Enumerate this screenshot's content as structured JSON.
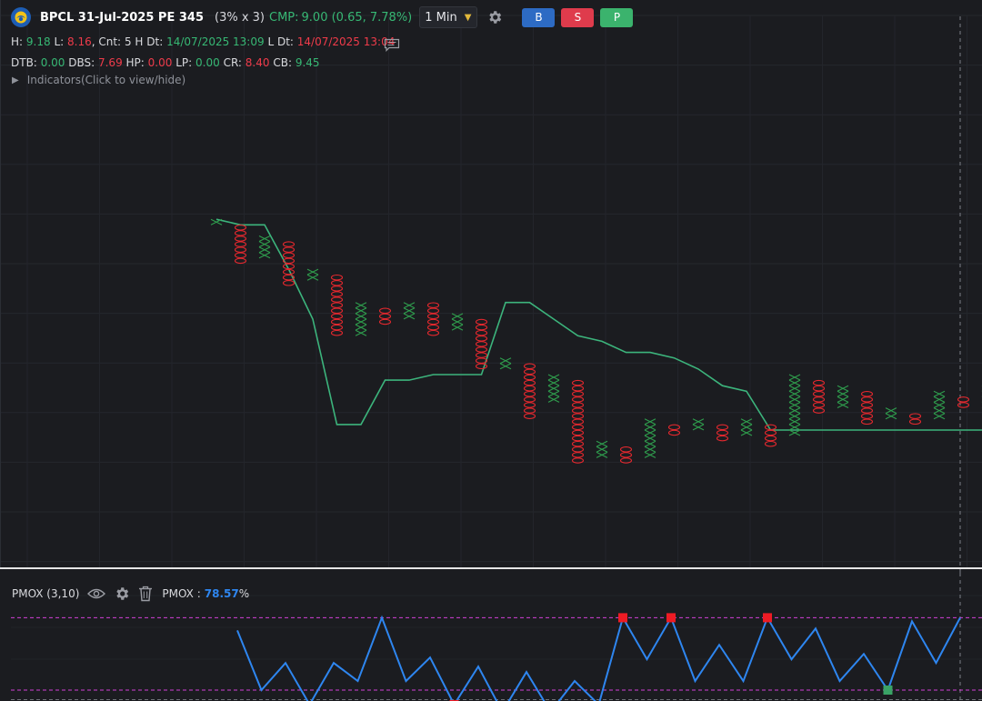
{
  "header": {
    "symbol": "BPCL 31-Jul-2025 PE 345",
    "box_info": "(3% x 3)",
    "cmp_label": "CMP:",
    "cmp_value": "9.00 (0.65, 7.78%)",
    "timeframe": "1 Min",
    "buttons": {
      "buy": "B",
      "sell": "S",
      "p": "P"
    }
  },
  "stats_row1": {
    "h_label": "H:",
    "h_value": "9.18",
    "l_label": "L:",
    "l_value": "8.16",
    "cnt_label": ", Cnt:",
    "cnt_value": "5",
    "hdt_label": "H Dt:",
    "hdt_value": "14/07/2025 13:09",
    "ldt_label": "L Dt:",
    "ldt_value": "14/07/2025 13:04"
  },
  "stats_row2": {
    "dtb_label": "DTB:",
    "dtb_value": "0.00",
    "dbs_label": "DBS:",
    "dbs_value": "7.69",
    "hp_label": "HP:",
    "hp_value": "0.00",
    "lp_label": "LP:",
    "lp_value": "0.00",
    "cr_label": "CR:",
    "cr_value": "8.40",
    "cb_label": "CB:",
    "cb_value": "9.45"
  },
  "indicators_toggle": "Indicators(Click to view/hide)",
  "pmox_panel": {
    "title": "PMOX (3,10)",
    "value_label": "PMOX :",
    "value": "78.57",
    "unit": "%"
  },
  "colors": {
    "x_mark": "#2f9e4d",
    "o_mark": "#e5282e",
    "trend_line": "#3cb47c",
    "pmox_line": "#2e86f0",
    "pmox_band": "#d23fd6",
    "signal_sell": "#ee1b24",
    "signal_buy": "#3aa366",
    "accent": "#2e86f0"
  },
  "icons": [
    "logo-icon",
    "chevron-down-icon",
    "gear-icon",
    "comment-icon",
    "triangle-right-icon",
    "eye-icon",
    "trash-icon"
  ],
  "chart_data": [
    {
      "type": "point-and-figure",
      "columns": [
        {
          "kind": "X",
          "high": 37.5,
          "low": 37.5
        },
        {
          "kind": "O",
          "high": 36.5,
          "low": 30.5
        },
        {
          "kind": "X",
          "high": 34.5,
          "low": 31.5
        },
        {
          "kind": "O",
          "high": 33.5,
          "low": 26.5
        },
        {
          "kind": "X",
          "high": 28.5,
          "low": 27.5
        },
        {
          "kind": "O",
          "high": 27.5,
          "low": 17.5
        },
        {
          "kind": "X",
          "high": 22.5,
          "low": 17.5
        },
        {
          "kind": "O",
          "high": 21.5,
          "low": 19.5
        },
        {
          "kind": "X",
          "high": 22.5,
          "low": 20.5
        },
        {
          "kind": "O",
          "high": 22.5,
          "low": 17.5
        },
        {
          "kind": "X",
          "high": 20.5,
          "low": 18.5
        },
        {
          "kind": "O",
          "high": 19.5,
          "low": 11.5
        },
        {
          "kind": "X",
          "high": 12.5,
          "low": 11.5
        },
        {
          "kind": "O",
          "high": 11.5,
          "low": 2.5
        },
        {
          "kind": "X",
          "high": 9.5,
          "low": 5.5
        },
        {
          "kind": "O",
          "high": 8.5,
          "low": -5.5
        },
        {
          "kind": "X",
          "high": -2.5,
          "low": -4.5
        },
        {
          "kind": "O",
          "high": -3.5,
          "low": -5.5
        },
        {
          "kind": "X",
          "high": 1.5,
          "low": -4.5
        },
        {
          "kind": "O",
          "high": 0.5,
          "low": -0.5
        },
        {
          "kind": "X",
          "high": 1.5,
          "low": 0.5
        },
        {
          "kind": "O",
          "high": 0.5,
          "low": -1.5
        },
        {
          "kind": "X",
          "high": 1.5,
          "low": -0.5
        },
        {
          "kind": "O",
          "high": 0.5,
          "low": -2.5
        },
        {
          "kind": "X",
          "high": 9.5,
          "low": -0.5
        },
        {
          "kind": "O",
          "high": 8.5,
          "low": 3.5
        },
        {
          "kind": "X",
          "high": 7.5,
          "low": 4.5
        },
        {
          "kind": "O",
          "high": 6.5,
          "low": 1.5
        },
        {
          "kind": "X",
          "high": 3.5,
          "low": 2.5
        },
        {
          "kind": "O",
          "high": 2.5,
          "low": 1.5
        },
        {
          "kind": "X",
          "high": 6.5,
          "low": 2.5
        },
        {
          "kind": "O",
          "high": 5.5,
          "low": 4.5
        },
        {
          "kind": "X",
          "high": 7.5,
          "low": 4.5
        }
      ],
      "trend_line": [
        38,
        37,
        37,
        29,
        20,
        1,
        1,
        9,
        9,
        10,
        10,
        10,
        23,
        23,
        20,
        17,
        16,
        14,
        14,
        13,
        11,
        8,
        7,
        0,
        0,
        0,
        0,
        0,
        0,
        0,
        0,
        0,
        0
      ]
    },
    {
      "type": "line",
      "title": "PMOX (3,10)",
      "series": [
        {
          "values": [
            null,
            null,
            null,
            null,
            null,
            null,
            null,
            null,
            null,
            null,
            33,
            0,
            15,
            -8,
            15,
            5,
            40,
            5,
            18,
            -8,
            13,
            -12,
            10,
            -12,
            5,
            -8,
            40,
            17,
            40,
            5,
            25,
            5,
            40,
            17,
            34,
            5,
            20,
            0,
            38,
            15,
            40
          ]
        }
      ],
      "upper_band": 40,
      "lower_band": 0,
      "sell_signals": [
        {
          "i": 26,
          "v": 40
        },
        {
          "i": 28,
          "v": 40
        },
        {
          "i": 32,
          "v": 40
        }
      ],
      "buy_signals": [
        {
          "i": 37,
          "v": 0
        }
      ],
      "low_markers": [
        {
          "i": 19,
          "v": -8
        },
        {
          "i": 23,
          "v": -12
        }
      ]
    }
  ]
}
